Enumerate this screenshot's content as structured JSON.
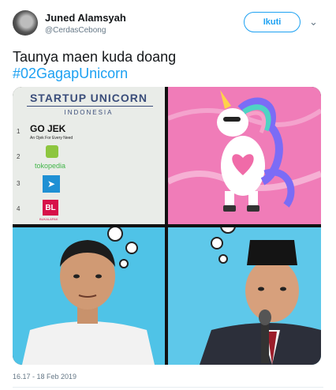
{
  "user": {
    "name": "Juned Alamsyah",
    "handle": "@CerdasCebong"
  },
  "follow_label": "Ikuti",
  "tweet": {
    "text": "Taunya maen kuda doang",
    "hashtag": "#02GagapUnicorn"
  },
  "image": {
    "title": "STARTUP UNICORN",
    "subtitle": "INDONESIA",
    "rows": [
      {
        "num": "1",
        "brand": "GO JEK",
        "tagline": "An Ojek For Every Need"
      },
      {
        "num": "2",
        "brand": "tokopedia"
      },
      {
        "num": "3",
        "brand": "traveloka"
      },
      {
        "num": "4",
        "brand": "BL",
        "tagline": "BUKALAPAK"
      }
    ]
  },
  "timestamp": "16.17 - 18 Feb 2019",
  "colors": {
    "accent": "#1da1f2",
    "pink": "#f07cb8",
    "sky": "#4fc3e7"
  }
}
